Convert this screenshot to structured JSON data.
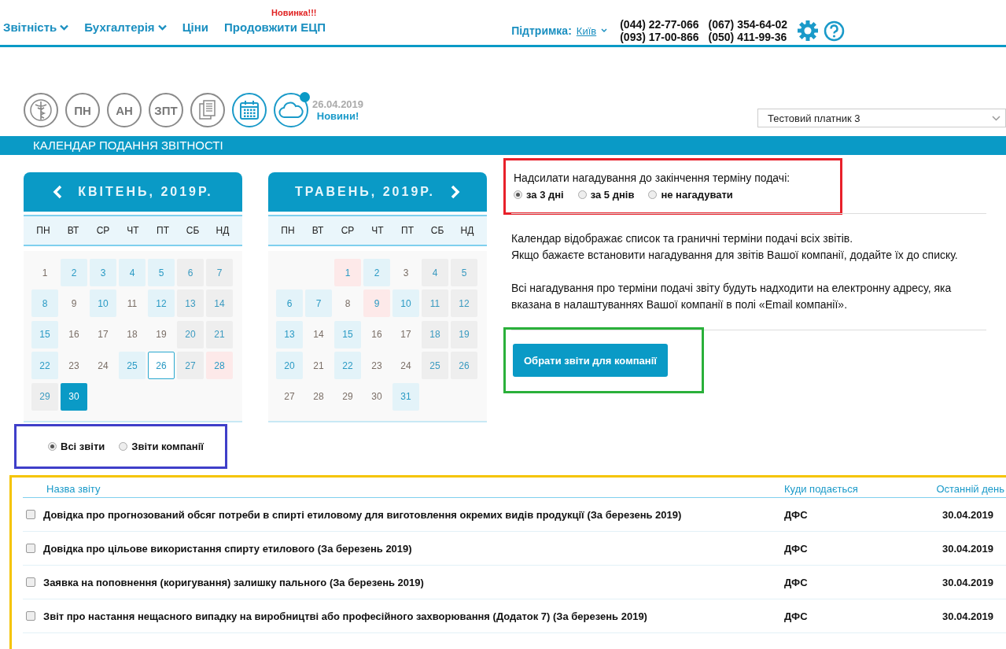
{
  "nav": [
    {
      "label": "Звітність",
      "dropdown": true
    },
    {
      "label": "Бухгалтерія",
      "dropdown": true
    },
    {
      "label": "Ціни",
      "dropdown": false
    },
    {
      "label": "Продовжити ЕЦП",
      "dropdown": false,
      "badge": "Новинка!!!"
    }
  ],
  "support": {
    "label": "Підтримка:",
    "city": "Київ",
    "phones": [
      "(044) 22-77-066",
      "(067) 354-64-02",
      "(093) 17-00-866",
      "(050) 411-99-36"
    ]
  },
  "toolbar": [
    {
      "kind": "caduceus",
      "selected": false
    },
    {
      "kind": "text",
      "label": "ПН",
      "selected": false
    },
    {
      "kind": "text",
      "label": "АН",
      "selected": false
    },
    {
      "kind": "text",
      "label": "ЗПТ",
      "selected": false
    },
    {
      "kind": "documents",
      "selected": false
    },
    {
      "kind": "calendar",
      "selected": true
    },
    {
      "kind": "cloud",
      "selected": true,
      "notification": true
    }
  ],
  "news": {
    "date": "26.04.2019",
    "link": "Новини!"
  },
  "payer_select": {
    "value": "Тестовий платник 3"
  },
  "section_title": "КАЛЕНДАР ПОДАННЯ ЗВІТНОСТІ",
  "calendars": [
    {
      "title": "КВІТЕНЬ, 2019Р.",
      "weekdays": [
        "ПН",
        "ВТ",
        "СР",
        "ЧТ",
        "ПТ",
        "СБ",
        "НД"
      ],
      "weeks": [
        [
          {
            "day": "1",
            "kind": "plain"
          },
          {
            "day": "2",
            "kind": "report"
          },
          {
            "day": "3",
            "kind": "report"
          },
          {
            "day": "4",
            "kind": "report"
          },
          {
            "day": "5",
            "kind": "report"
          },
          {
            "day": "6",
            "kind": "weekend"
          },
          {
            "day": "7",
            "kind": "weekend"
          }
        ],
        [
          {
            "day": "8",
            "kind": "report"
          },
          {
            "day": "9",
            "kind": "plain"
          },
          {
            "day": "10",
            "kind": "report"
          },
          {
            "day": "11",
            "kind": "plain"
          },
          {
            "day": "12",
            "kind": "report"
          },
          {
            "day": "13",
            "kind": "weekend"
          },
          {
            "day": "14",
            "kind": "weekend"
          }
        ],
        [
          {
            "day": "15",
            "kind": "report"
          },
          {
            "day": "16",
            "kind": "plain"
          },
          {
            "day": "17",
            "kind": "plain"
          },
          {
            "day": "18",
            "kind": "plain"
          },
          {
            "day": "19",
            "kind": "plain"
          },
          {
            "day": "20",
            "kind": "weekend"
          },
          {
            "day": "21",
            "kind": "weekend"
          }
        ],
        [
          {
            "day": "22",
            "kind": "report"
          },
          {
            "day": "23",
            "kind": "plain"
          },
          {
            "day": "24",
            "kind": "plain"
          },
          {
            "day": "25",
            "kind": "report"
          },
          {
            "day": "26",
            "kind": "today"
          },
          {
            "day": "27",
            "kind": "weekend"
          },
          {
            "day": "28",
            "kind": "holiday"
          }
        ],
        [
          {
            "day": "29",
            "kind": "weekend"
          },
          {
            "day": "30",
            "kind": "selected"
          }
        ]
      ]
    },
    {
      "title": "ТРАВЕНЬ, 2019Р.",
      "weekdays": [
        "ПН",
        "ВТ",
        "СР",
        "ЧТ",
        "ПТ",
        "СБ",
        "НД"
      ],
      "weeks": [
        [
          {
            "kind": "blank"
          },
          {
            "kind": "blank"
          },
          {
            "day": "1",
            "kind": "holiday"
          },
          {
            "day": "2",
            "kind": "report"
          },
          {
            "day": "3",
            "kind": "plain"
          },
          {
            "day": "4",
            "kind": "weekend"
          },
          {
            "day": "5",
            "kind": "weekend"
          }
        ],
        [
          {
            "day": "6",
            "kind": "report"
          },
          {
            "day": "7",
            "kind": "report"
          },
          {
            "day": "8",
            "kind": "plain"
          },
          {
            "day": "9",
            "kind": "holiday"
          },
          {
            "day": "10",
            "kind": "report"
          },
          {
            "day": "11",
            "kind": "weekend"
          },
          {
            "day": "12",
            "kind": "weekend"
          }
        ],
        [
          {
            "day": "13",
            "kind": "report"
          },
          {
            "day": "14",
            "kind": "plain"
          },
          {
            "day": "15",
            "kind": "report"
          },
          {
            "day": "16",
            "kind": "plain"
          },
          {
            "day": "17",
            "kind": "plain"
          },
          {
            "day": "18",
            "kind": "weekend"
          },
          {
            "day": "19",
            "kind": "weekend"
          }
        ],
        [
          {
            "day": "20",
            "kind": "report"
          },
          {
            "day": "21",
            "kind": "plain"
          },
          {
            "day": "22",
            "kind": "report"
          },
          {
            "day": "23",
            "kind": "plain"
          },
          {
            "day": "24",
            "kind": "plain"
          },
          {
            "day": "25",
            "kind": "weekend"
          },
          {
            "day": "26",
            "kind": "weekend"
          }
        ],
        [
          {
            "day": "27",
            "kind": "plain"
          },
          {
            "day": "28",
            "kind": "plain"
          },
          {
            "day": "29",
            "kind": "plain"
          },
          {
            "day": "30",
            "kind": "plain"
          },
          {
            "day": "31",
            "kind": "report"
          }
        ]
      ]
    }
  ],
  "report_filter": [
    {
      "label": "Всі звіти",
      "selected": true
    },
    {
      "label": "Звіти компанії",
      "selected": false
    }
  ],
  "reminder": {
    "label": "Надсилати нагадування до закінчення терміну подачі:",
    "options": [
      {
        "label": "за 3 дні",
        "selected": true
      },
      {
        "label": "за 5 днів",
        "selected": false
      },
      {
        "label": "не нагадувати",
        "selected": false
      }
    ]
  },
  "info": [
    "Календар відображає список та граничні терміни подачі всіх звітів.\nЯкщо бажаєте встановити нагадування для звітів Вашої компанії, додайте їх до списку.",
    "Всі нагадування про терміни подачі звіту будуть надходити на електронну адресу, яка вказана в налаштуваннях Вашої компанії в полі «Email компанії»."
  ],
  "choose_button": "Обрати звіти для компанії",
  "table": {
    "columns": [
      "Назва звіту",
      "Куди подається",
      "Останній день"
    ],
    "rows": [
      {
        "checked": false,
        "name": "Довідка про прогнозований обсяг потреби в спирті етиловому для виготовлення окремих видів продукції (За березень 2019)",
        "destination": "ДФС",
        "deadline": "30.04.2019"
      },
      {
        "checked": false,
        "name": "Довідка про цільове використання спирту етилового (За березень 2019)",
        "destination": "ДФС",
        "deadline": "30.04.2019"
      },
      {
        "checked": false,
        "name": "Заявка на поповнення (коригування) залишку пального (За березень 2019)",
        "destination": "ДФС",
        "deadline": "30.04.2019"
      },
      {
        "checked": false,
        "name": "Звіт про настання нещасного випадку на виробництві або професійного захворювання (Додаток 7) (За березень 2019)",
        "destination": "ДФС",
        "deadline": "30.04.2019"
      }
    ]
  }
}
